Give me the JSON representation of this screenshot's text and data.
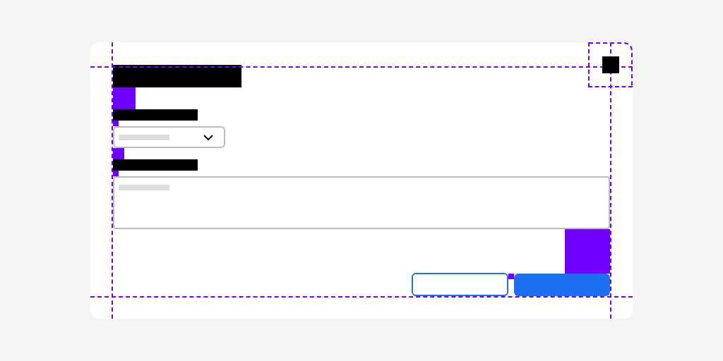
{
  "modal": {
    "close_button": true,
    "fields": [
      {
        "kind": "dropdown"
      },
      {
        "kind": "textarea"
      }
    ],
    "buttons": [
      {
        "kind": "secondary"
      },
      {
        "kind": "primary"
      }
    ]
  }
}
